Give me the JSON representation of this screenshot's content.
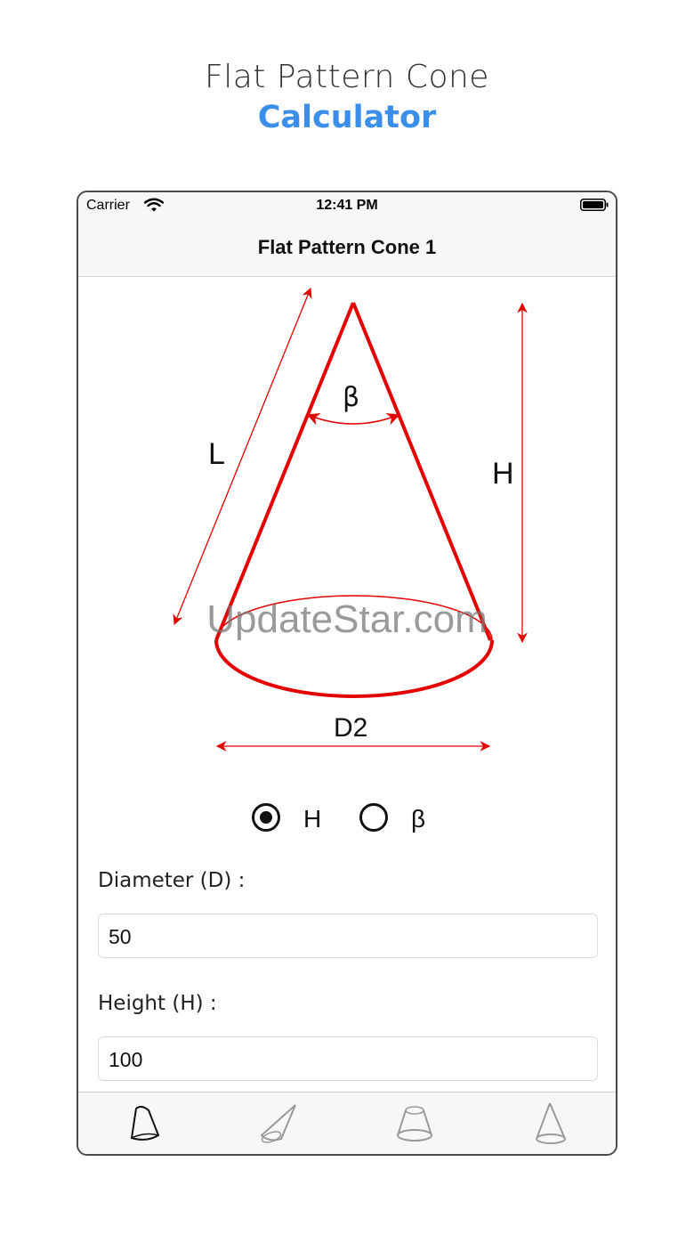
{
  "hero": {
    "title": "Flat Pattern Cone",
    "subtitle": "Calculator",
    "subtitle_color": "#3b8ee9"
  },
  "status_bar": {
    "carrier": "Carrier",
    "time": "12:41 PM",
    "icons": [
      "wifi-icon",
      "battery-icon"
    ]
  },
  "nav": {
    "title": "Flat Pattern Cone 1"
  },
  "diagram": {
    "labels": {
      "slant": "L",
      "angle": "β",
      "height": "H",
      "diameter": "D2"
    },
    "line_color": "#e50000"
  },
  "watermark": "UpdateStar.com",
  "mode": {
    "options": [
      {
        "label": "H",
        "selected": true
      },
      {
        "label": "β",
        "selected": false
      }
    ]
  },
  "fields": [
    {
      "label": "Diameter (D) :",
      "value": "50"
    },
    {
      "label": "Height (H) :",
      "value": "100"
    }
  ],
  "tabs": [
    {
      "icon": "cone-frustum-icon",
      "active": true
    },
    {
      "icon": "cone-side-icon",
      "active": false
    },
    {
      "icon": "truncated-cone-icon",
      "active": false
    },
    {
      "icon": "cone-icon",
      "active": false
    }
  ]
}
